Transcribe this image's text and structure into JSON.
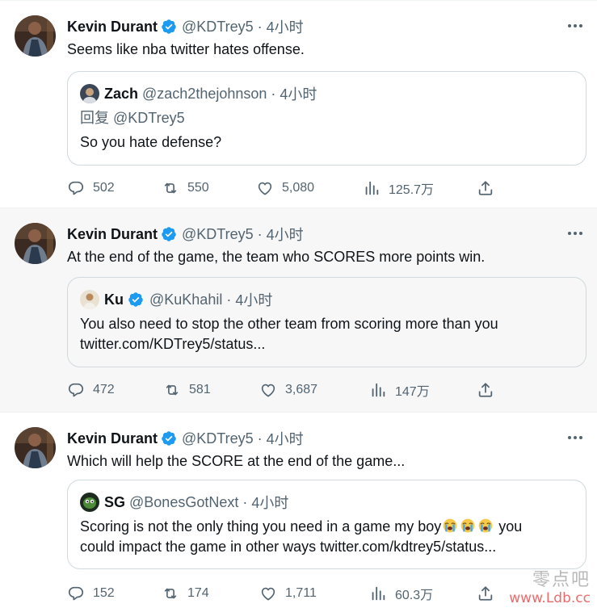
{
  "colors": {
    "text": "#0f1419",
    "secondary": "#536471",
    "verified": "#1d9bf0",
    "border": "#cfd9de",
    "highlight_bg": "#f7f7f7"
  },
  "tweets": [
    {
      "author": {
        "name": "Kevin Durant",
        "handle": "@KDTrey5",
        "verified": true
      },
      "separator": "·",
      "time": "4小时",
      "text": "Seems like nba twitter hates offense.",
      "quote": {
        "name": "Zach",
        "handle": "@zach2thejohnson",
        "verified": false,
        "time": "4小时",
        "reply_prefix": "回复",
        "reply_to": "@KDTrey5",
        "line1": "",
        "line2": "So you hate defense?"
      },
      "stats": {
        "replies": "502",
        "retweets": "550",
        "likes": "5,080",
        "views": "125.7万"
      }
    },
    {
      "author": {
        "name": "Kevin Durant",
        "handle": "@KDTrey5",
        "verified": true
      },
      "separator": "·",
      "time": "4小时",
      "text": "At the end of the game, the team who SCORES more points win.",
      "quote": {
        "name": "Ku",
        "handle": "@KuKhahil",
        "verified": true,
        "time": "4小时",
        "line1": "You also need to stop the other team from scoring more than you",
        "line2": "twitter.com/KDTrey5/status..."
      },
      "stats": {
        "replies": "472",
        "retweets": "581",
        "likes": "3,687",
        "views": "147万"
      }
    },
    {
      "author": {
        "name": "Kevin Durant",
        "handle": "@KDTrey5",
        "verified": true
      },
      "separator": "·",
      "time": "4小时",
      "text": "Which will help the SCORE at the end of the game...",
      "quote": {
        "name": "SG",
        "handle": "@BonesGotNext",
        "verified": false,
        "time": "4小时",
        "line1_before": "Scoring is not the only thing you need in a game my boy",
        "line1_emoji": "loudly-crying-face x3",
        "line1_after": " you",
        "line2": "could impact the game in other ways twitter.com/kdtrey5/status..."
      },
      "stats": {
        "replies": "152",
        "retweets": "174",
        "likes": "1,711",
        "views": "60.3万"
      }
    }
  ],
  "watermark": {
    "line1": "零点吧",
    "line2": "www.Ldb.cc"
  },
  "icons": {
    "reply": "reply-icon",
    "retweet": "retweet-icon",
    "like": "heart-icon",
    "views": "views-icon",
    "share": "share-icon",
    "more": "more-icon",
    "verified": "verified-badge-icon"
  }
}
